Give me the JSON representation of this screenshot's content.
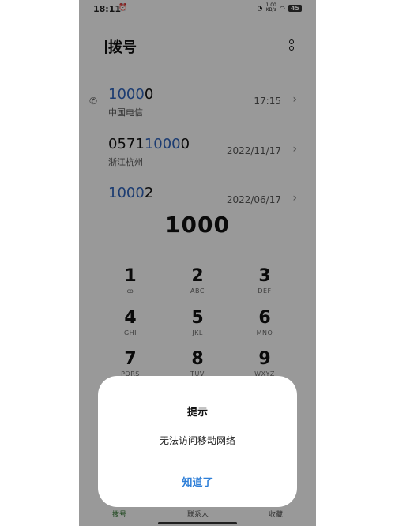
{
  "status_bar": {
    "time": "18:11",
    "alarm": "⏰",
    "speed_value": "1.00",
    "speed_unit": "KB/s",
    "battery": "45"
  },
  "header": {
    "title": "拨号"
  },
  "call_log": [
    {
      "number_match": "1000",
      "number_rest": "0",
      "number_prefix": "",
      "location": "中国电信",
      "time": "17:15"
    },
    {
      "number_prefix": "0571",
      "number_match": "1000",
      "number_rest": "0",
      "location": "浙江杭州",
      "time": "2022/11/17"
    },
    {
      "number_prefix": "",
      "number_match": "1000",
      "number_rest": "2",
      "location": "",
      "time": "2022/06/17"
    }
  ],
  "dial_display": "1000",
  "keypad": [
    {
      "digit": "1",
      "letters": "ꝏ"
    },
    {
      "digit": "2",
      "letters": "ABC"
    },
    {
      "digit": "3",
      "letters": "DEF"
    },
    {
      "digit": "4",
      "letters": "GHI"
    },
    {
      "digit": "5",
      "letters": "JKL"
    },
    {
      "digit": "6",
      "letters": "MNO"
    },
    {
      "digit": "7",
      "letters": "PQRS"
    },
    {
      "digit": "8",
      "letters": "TUV"
    },
    {
      "digit": "9",
      "letters": "WXYZ"
    }
  ],
  "bottom_nav": [
    {
      "label": "拨号"
    },
    {
      "label": "联系人"
    },
    {
      "label": "收藏"
    }
  ],
  "dialog": {
    "title": "提示",
    "message": "无法访问移动网络",
    "button": "知道了"
  },
  "colors": {
    "highlight": "#2e62b8",
    "dialog_button": "#2f7fd8",
    "nav_active": "#3a7a3a"
  }
}
